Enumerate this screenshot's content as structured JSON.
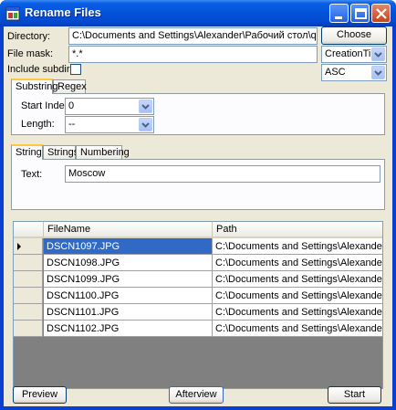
{
  "window": {
    "title": "Rename Files"
  },
  "form": {
    "directory_label": "Directory:",
    "directory_value": "C:\\Documents and Settings\\Alexander\\Рабочий стол\\qqq",
    "choose_label": "Choose",
    "filemask_label": "File mask:",
    "filemask_value": "*.*",
    "sort_field": "CreationTime",
    "sort_order": "ASC",
    "include_subdirs_label": "Include subdirs:"
  },
  "tabs1": {
    "items": [
      "Substring",
      "Regex"
    ],
    "active": "Substring",
    "start_index_label": "Start Index:",
    "start_index_value": "0",
    "length_label": "Length:",
    "length_value": "--"
  },
  "tabs2": {
    "items": [
      "String",
      "Strings",
      "Numbering"
    ],
    "active": "String",
    "text_label": "Text:",
    "text_value": "Moscow"
  },
  "grid": {
    "columns": [
      "FileName",
      "Path"
    ],
    "rows": [
      [
        "DSCN1097.JPG",
        "C:\\Documents and Settings\\Alexander\\Рабо..."
      ],
      [
        "DSCN1098.JPG",
        "C:\\Documents and Settings\\Alexander\\Рабо..."
      ],
      [
        "DSCN1099.JPG",
        "C:\\Documents and Settings\\Alexander\\Рабо..."
      ],
      [
        "DSCN1100.JPG",
        "C:\\Documents and Settings\\Alexander\\Рабо..."
      ],
      [
        "DSCN1101.JPG",
        "C:\\Documents and Settings\\Alexander\\Рабо..."
      ],
      [
        "DSCN1102.JPG",
        "C:\\Documents and Settings\\Alexander\\Рабо..."
      ]
    ]
  },
  "buttons": {
    "preview": "Preview",
    "afterview": "Afterview",
    "start": "Start"
  }
}
